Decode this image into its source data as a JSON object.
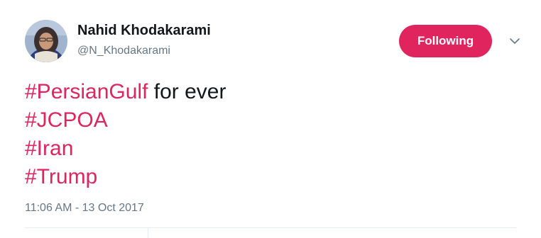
{
  "author": {
    "display_name": "Nahid Khodakarami",
    "handle": "@N_Khodakarami",
    "avatar_icon": "user-avatar-photo"
  },
  "follow_button": {
    "label": "Following",
    "color": "#e0245e"
  },
  "menu": {
    "icon": "chevron-down-icon"
  },
  "tweet": {
    "lines": [
      {
        "hashtag": "#PersianGulf",
        "text": " for ever"
      },
      {
        "hashtag": "#JCPOA",
        "text": ""
      },
      {
        "hashtag": "#Iran",
        "text": ""
      },
      {
        "hashtag": "#Trump",
        "text": ""
      }
    ],
    "timestamp": "11:06 AM - 13 Oct 2017"
  },
  "colors": {
    "hashtag": "#e0245e",
    "text": "#14171a",
    "secondary": "#657786",
    "divider": "#e6ecf0"
  }
}
